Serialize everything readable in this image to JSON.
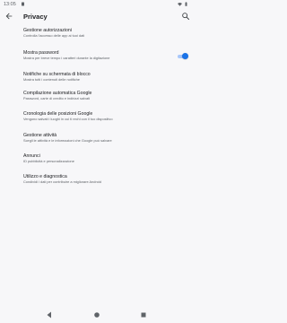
{
  "status_bar": {
    "time": "13:05",
    "icons": [
      "status-app-icon",
      "wifi-icon",
      "battery-icon"
    ]
  },
  "header": {
    "title": "Privacy",
    "back_icon": "arrow-back-icon",
    "search_icon": "search-icon"
  },
  "settings": [
    {
      "title": "Gestione autorizzazioni",
      "subtitle": "Controlla l'accesso delle app ai tuoi dati"
    },
    {
      "title": "Mostra password",
      "subtitle": "Mostra per breve tempo i caratteri durante la digitazione",
      "toggle_on": true
    },
    {
      "title": "Notifiche su schermata di blocco",
      "subtitle": "Mostra tutti i contenuti delle notifiche"
    },
    {
      "title": "Compilazione automatica Google",
      "subtitle": "Password, carte di credito e indirizzi salvati"
    },
    {
      "title": "Cronologia delle posizioni Google",
      "subtitle": "Vengono salvati i luoghi in cui ti rechi con il tuo dispositivo"
    },
    {
      "title": "Gestione attività",
      "subtitle": "Scegli le attività e le informazioni che Google può salvare"
    },
    {
      "title": "Annunci",
      "subtitle": "ID pubblicità e personalizzazione"
    },
    {
      "title": "Utilizzo e diagnostica",
      "subtitle": "Condividi i dati per contribuire a migliorare Android"
    }
  ],
  "nav_bar": {
    "icons": [
      "nav-back-icon",
      "nav-home-icon",
      "nav-recents-icon"
    ]
  },
  "colors": {
    "accent": "#1a73e8",
    "background": "#f7f7f9",
    "text_primary": "#202124",
    "text_secondary": "#5f6368"
  }
}
